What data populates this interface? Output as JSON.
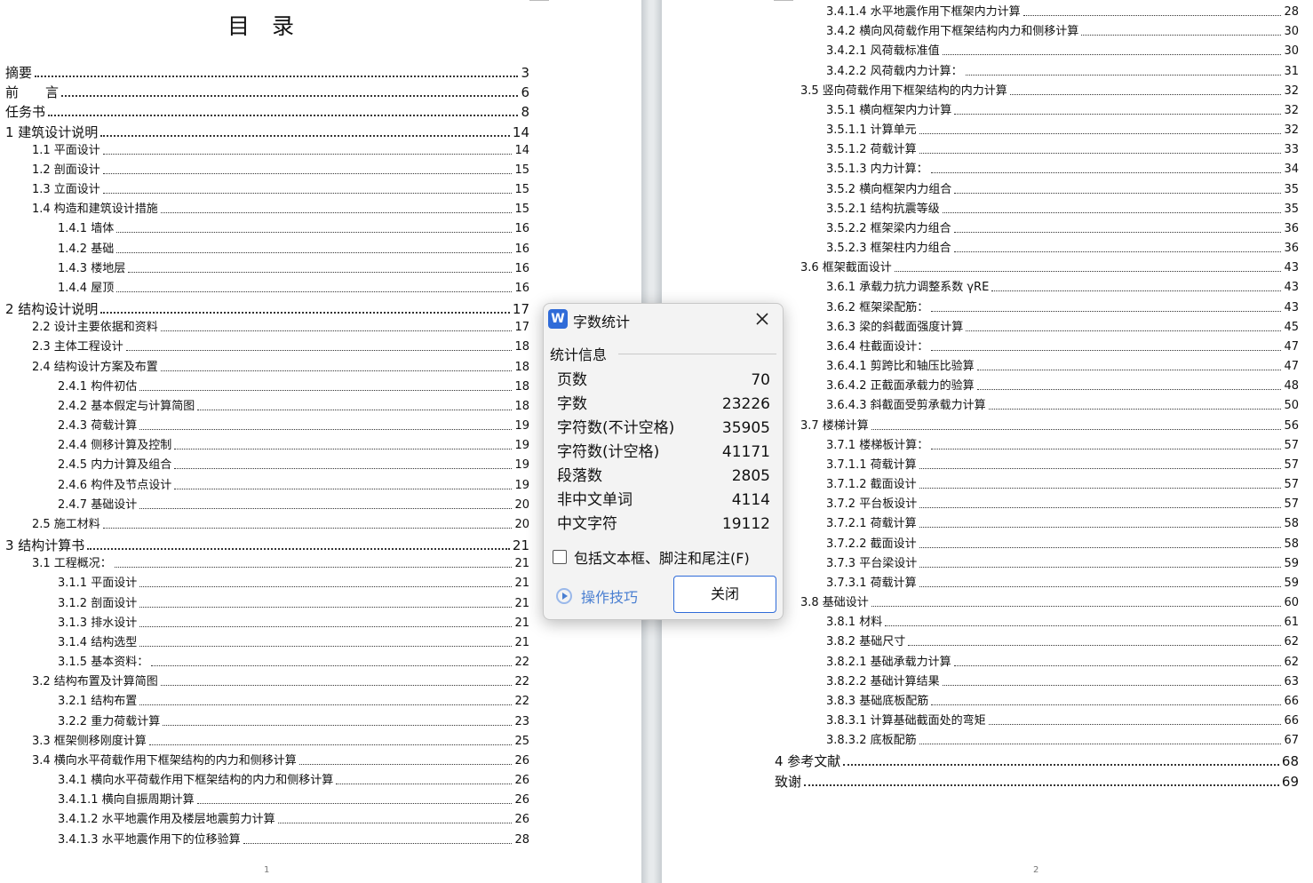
{
  "left_page": {
    "title": "目　录",
    "page_number": "1",
    "entries": [
      {
        "text": "摘要",
        "page": "3",
        "level": 1
      },
      {
        "text": "前　　言",
        "page": "6",
        "level": 1
      },
      {
        "text": "任务书",
        "page": "8",
        "level": 1
      },
      {
        "text": "1 建筑设计说明",
        "page": "14",
        "level": 1
      },
      {
        "text": "1.1 平面设计",
        "page": "14",
        "level": 2
      },
      {
        "text": "1.2 剖面设计",
        "page": "15",
        "level": 2
      },
      {
        "text": "1.3 立面设计",
        "page": "15",
        "level": 2
      },
      {
        "text": "1.4 构造和建筑设计措施",
        "page": "15",
        "level": 2
      },
      {
        "text": "1.4.1 墙体",
        "page": "16",
        "level": 3
      },
      {
        "text": "1.4.2 基础",
        "page": "16",
        "level": 3
      },
      {
        "text": "1.4.3 楼地层",
        "page": "16",
        "level": 3
      },
      {
        "text": "1.4.4 屋顶",
        "page": "16",
        "level": 3
      },
      {
        "text": "2 结构设计说明",
        "page": "17",
        "level": 1
      },
      {
        "text": "2.2 设计主要依据和资料",
        "page": "17",
        "level": 2
      },
      {
        "text": "2.3 主体工程设计",
        "page": "18",
        "level": 2
      },
      {
        "text": "2.4 结构设计方案及布置",
        "page": "18",
        "level": 2
      },
      {
        "text": "2.4.1 构件初估",
        "page": "18",
        "level": 3
      },
      {
        "text": "2.4.2 基本假定与计算简图",
        "page": "18",
        "level": 3
      },
      {
        "text": "2.4.3 荷载计算",
        "page": "19",
        "level": 3
      },
      {
        "text": "2.4.4 侧移计算及控制",
        "page": "19",
        "level": 3
      },
      {
        "text": "2.4.5 内力计算及组合",
        "page": "19",
        "level": 3
      },
      {
        "text": "2.4.6 构件及节点设计",
        "page": "19",
        "level": 3
      },
      {
        "text": "2.4.7 基础设计",
        "page": "20",
        "level": 3
      },
      {
        "text": "2.5 施工材料",
        "page": "20",
        "level": 2
      },
      {
        "text": "3 结构计算书",
        "page": "21",
        "level": 1
      },
      {
        "text": "3.1 工程概况：",
        "page": "21",
        "level": 2
      },
      {
        "text": "3.1.1 平面设计",
        "page": "21",
        "level": 3
      },
      {
        "text": "3.1.2 剖面设计",
        "page": "21",
        "level": 3
      },
      {
        "text": "3.1.3 排水设计",
        "page": "21",
        "level": 3
      },
      {
        "text": "3.1.4 结构选型",
        "page": "21",
        "level": 3
      },
      {
        "text": "3.1.5 基本资料：",
        "page": "22",
        "level": 3
      },
      {
        "text": "3.2 结构布置及计算简图",
        "page": "22",
        "level": 2
      },
      {
        "text": "3.2.1 结构布置",
        "page": "22",
        "level": 3
      },
      {
        "text": "3.2.2 重力荷载计算",
        "page": "23",
        "level": 3
      },
      {
        "text": "3.3 框架侧移刚度计算",
        "page": "25",
        "level": 2
      },
      {
        "text": "3.4 横向水平荷载作用下框架结构的内力和侧移计算",
        "page": "26",
        "level": 2
      },
      {
        "text": "3.4.1 横向水平荷载作用下框架结构的内力和侧移计算",
        "page": "26",
        "level": 3
      },
      {
        "text": "3.4.1.1 横向自振周期计算",
        "page": "26",
        "level": 3
      },
      {
        "text": "3.4.1.2 水平地震作用及楼层地震剪力计算",
        "page": "26",
        "level": 3
      },
      {
        "text": "3.4.1.3 水平地震作用下的位移验算",
        "page": "28",
        "level": 3
      }
    ]
  },
  "right_page": {
    "page_number": "2",
    "entries": [
      {
        "text": "3.4.1.4 水平地震作用下框架内力计算",
        "page": "28",
        "level": 3
      },
      {
        "text": "3.4.2 横向风荷载作用下框架结构内力和侧移计算",
        "page": "30",
        "level": 3
      },
      {
        "text": "3.4.2.1 风荷载标准值",
        "page": "30",
        "level": 3
      },
      {
        "text": "3.4.2.2 风荷载内力计算：",
        "page": "31",
        "level": 3
      },
      {
        "text": "3.5 竖向荷载作用下框架结构的内力计算",
        "page": "32",
        "level": 2
      },
      {
        "text": "3.5.1 横向框架内力计算",
        "page": "32",
        "level": 3
      },
      {
        "text": "3.5.1.1 计算单元",
        "page": "32",
        "level": 3
      },
      {
        "text": "3.5.1.2 荷载计算",
        "page": "33",
        "level": 3
      },
      {
        "text": "3.5.1.3 内力计算：",
        "page": "34",
        "level": 3
      },
      {
        "text": "3.5.2 横向框架内力组合",
        "page": "35",
        "level": 3
      },
      {
        "text": "3.5.2.1 结构抗震等级",
        "page": "35",
        "level": 3
      },
      {
        "text": "3.5.2.2 框架梁内力组合",
        "page": "36",
        "level": 3
      },
      {
        "text": "3.5.2.3 框架柱内力组合",
        "page": "36",
        "level": 3
      },
      {
        "text": "3.6 框架截面设计",
        "page": "43",
        "level": 2
      },
      {
        "text": "3.6.1 承载力抗力调整系数 γRE",
        "page": "43",
        "level": 3
      },
      {
        "text": "3.6.2 框架梁配筋：",
        "page": "43",
        "level": 3
      },
      {
        "text": "3.6.3 梁的斜截面强度计算",
        "page": "45",
        "level": 3
      },
      {
        "text": "3.6.4 柱截面设计：",
        "page": "47",
        "level": 3
      },
      {
        "text": "3.6.4.1 剪跨比和轴压比验算",
        "page": "47",
        "level": 3
      },
      {
        "text": "3.6.4.2 正截面承载力的验算",
        "page": "48",
        "level": 3
      },
      {
        "text": "3.6.4.3 斜截面受剪承载力计算",
        "page": "50",
        "level": 3
      },
      {
        "text": "3.7 楼梯计算",
        "page": "56",
        "level": 2
      },
      {
        "text": "3.7.1 楼梯板计算：",
        "page": "57",
        "level": 3
      },
      {
        "text": "3.7.1.1 荷载计算",
        "page": "57",
        "level": 3
      },
      {
        "text": "3.7.1.2 截面设计",
        "page": "57",
        "level": 3
      },
      {
        "text": "3.7.2 平台板设计",
        "page": "57",
        "level": 3
      },
      {
        "text": "3.7.2.1 荷载计算",
        "page": "58",
        "level": 3
      },
      {
        "text": "3.7.2.2 截面设计",
        "page": "58",
        "level": 3
      },
      {
        "text": "3.7.3 平台梁设计",
        "page": "59",
        "level": 3
      },
      {
        "text": "3.7.3.1 荷载计算",
        "page": "59",
        "level": 3
      },
      {
        "text": "3.8 基础设计",
        "page": "60",
        "level": 2
      },
      {
        "text": "3.8.1 材料",
        "page": "61",
        "level": 3
      },
      {
        "text": "3.8.2 基础尺寸",
        "page": "62",
        "level": 3
      },
      {
        "text": "3.8.2.1 基础承载力计算",
        "page": "62",
        "level": 3
      },
      {
        "text": "3.8.2.2 基础计算结果",
        "page": "63",
        "level": 3
      },
      {
        "text": "3.8.3 基础底板配筋",
        "page": "66",
        "level": 3
      },
      {
        "text": "3.8.3.1 计算基础截面处的弯矩",
        "page": "66",
        "level": 3
      },
      {
        "text": "3.8.3.2 底板配筋",
        "page": "67",
        "level": 3
      },
      {
        "text": "4 参考文献",
        "page": "68",
        "level": 1
      },
      {
        "text": "致谢",
        "page": "69",
        "level": 1
      }
    ]
  },
  "dialog": {
    "logo_letter": "W",
    "title": "字数统计",
    "section_label": "统计信息",
    "stats": [
      {
        "label": "页数",
        "value": "70"
      },
      {
        "label": "字数",
        "value": "23226"
      },
      {
        "label": "字符数(不计空格)",
        "value": "35905"
      },
      {
        "label": "字符数(计空格)",
        "value": "41171"
      },
      {
        "label": "段落数",
        "value": "2805"
      },
      {
        "label": "非中文单词",
        "value": "4114"
      },
      {
        "label": "中文字符",
        "value": "19112"
      }
    ],
    "checkbox_label": "包括文本框、脚注和尾注(F)",
    "checkbox_checked": false,
    "tips_label": "操作技巧",
    "close_label": "关闭",
    "accent_color": "#2f6bd8"
  }
}
